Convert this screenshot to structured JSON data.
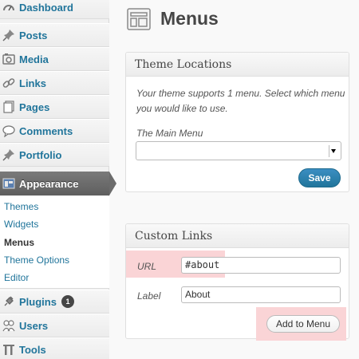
{
  "sidebar": {
    "items": [
      {
        "label": "Dashboard",
        "icon": "dashboard-icon"
      },
      {
        "label": "Posts",
        "icon": "pin-icon"
      },
      {
        "label": "Media",
        "icon": "media-icon"
      },
      {
        "label": "Links",
        "icon": "link-icon"
      },
      {
        "label": "Pages",
        "icon": "pages-icon"
      },
      {
        "label": "Comments",
        "icon": "comment-icon"
      },
      {
        "label": "Portfolio",
        "icon": "pin-icon"
      },
      {
        "label": "Appearance",
        "icon": "appearance-icon"
      },
      {
        "label": "Plugins",
        "icon": "plug-icon",
        "badge": "1"
      },
      {
        "label": "Users",
        "icon": "users-icon"
      },
      {
        "label": "Tools",
        "icon": "tools-icon"
      }
    ],
    "submenu": [
      "Themes",
      "Widgets",
      "Menus",
      "Theme Options",
      "Editor"
    ],
    "current_submenu": "Menus"
  },
  "page": {
    "title": "Menus",
    "icon": "menus-icon"
  },
  "theme_locations": {
    "title": "Theme Locations",
    "description": "Your theme supports 1 menu. Select which menu you would like to use.",
    "main_menu_label": "The Main Menu",
    "main_menu_value": "",
    "save_label": "Save"
  },
  "custom_links": {
    "title": "Custom Links",
    "url_label": "URL",
    "url_value": "#about",
    "label_label": "Label",
    "label_value": "About",
    "add_label": "Add to Menu"
  },
  "colors": {
    "link": "#21759b",
    "highlight": "#fad4d6",
    "primary_button": "#21759b",
    "active_menu": "#6b6b6b"
  }
}
